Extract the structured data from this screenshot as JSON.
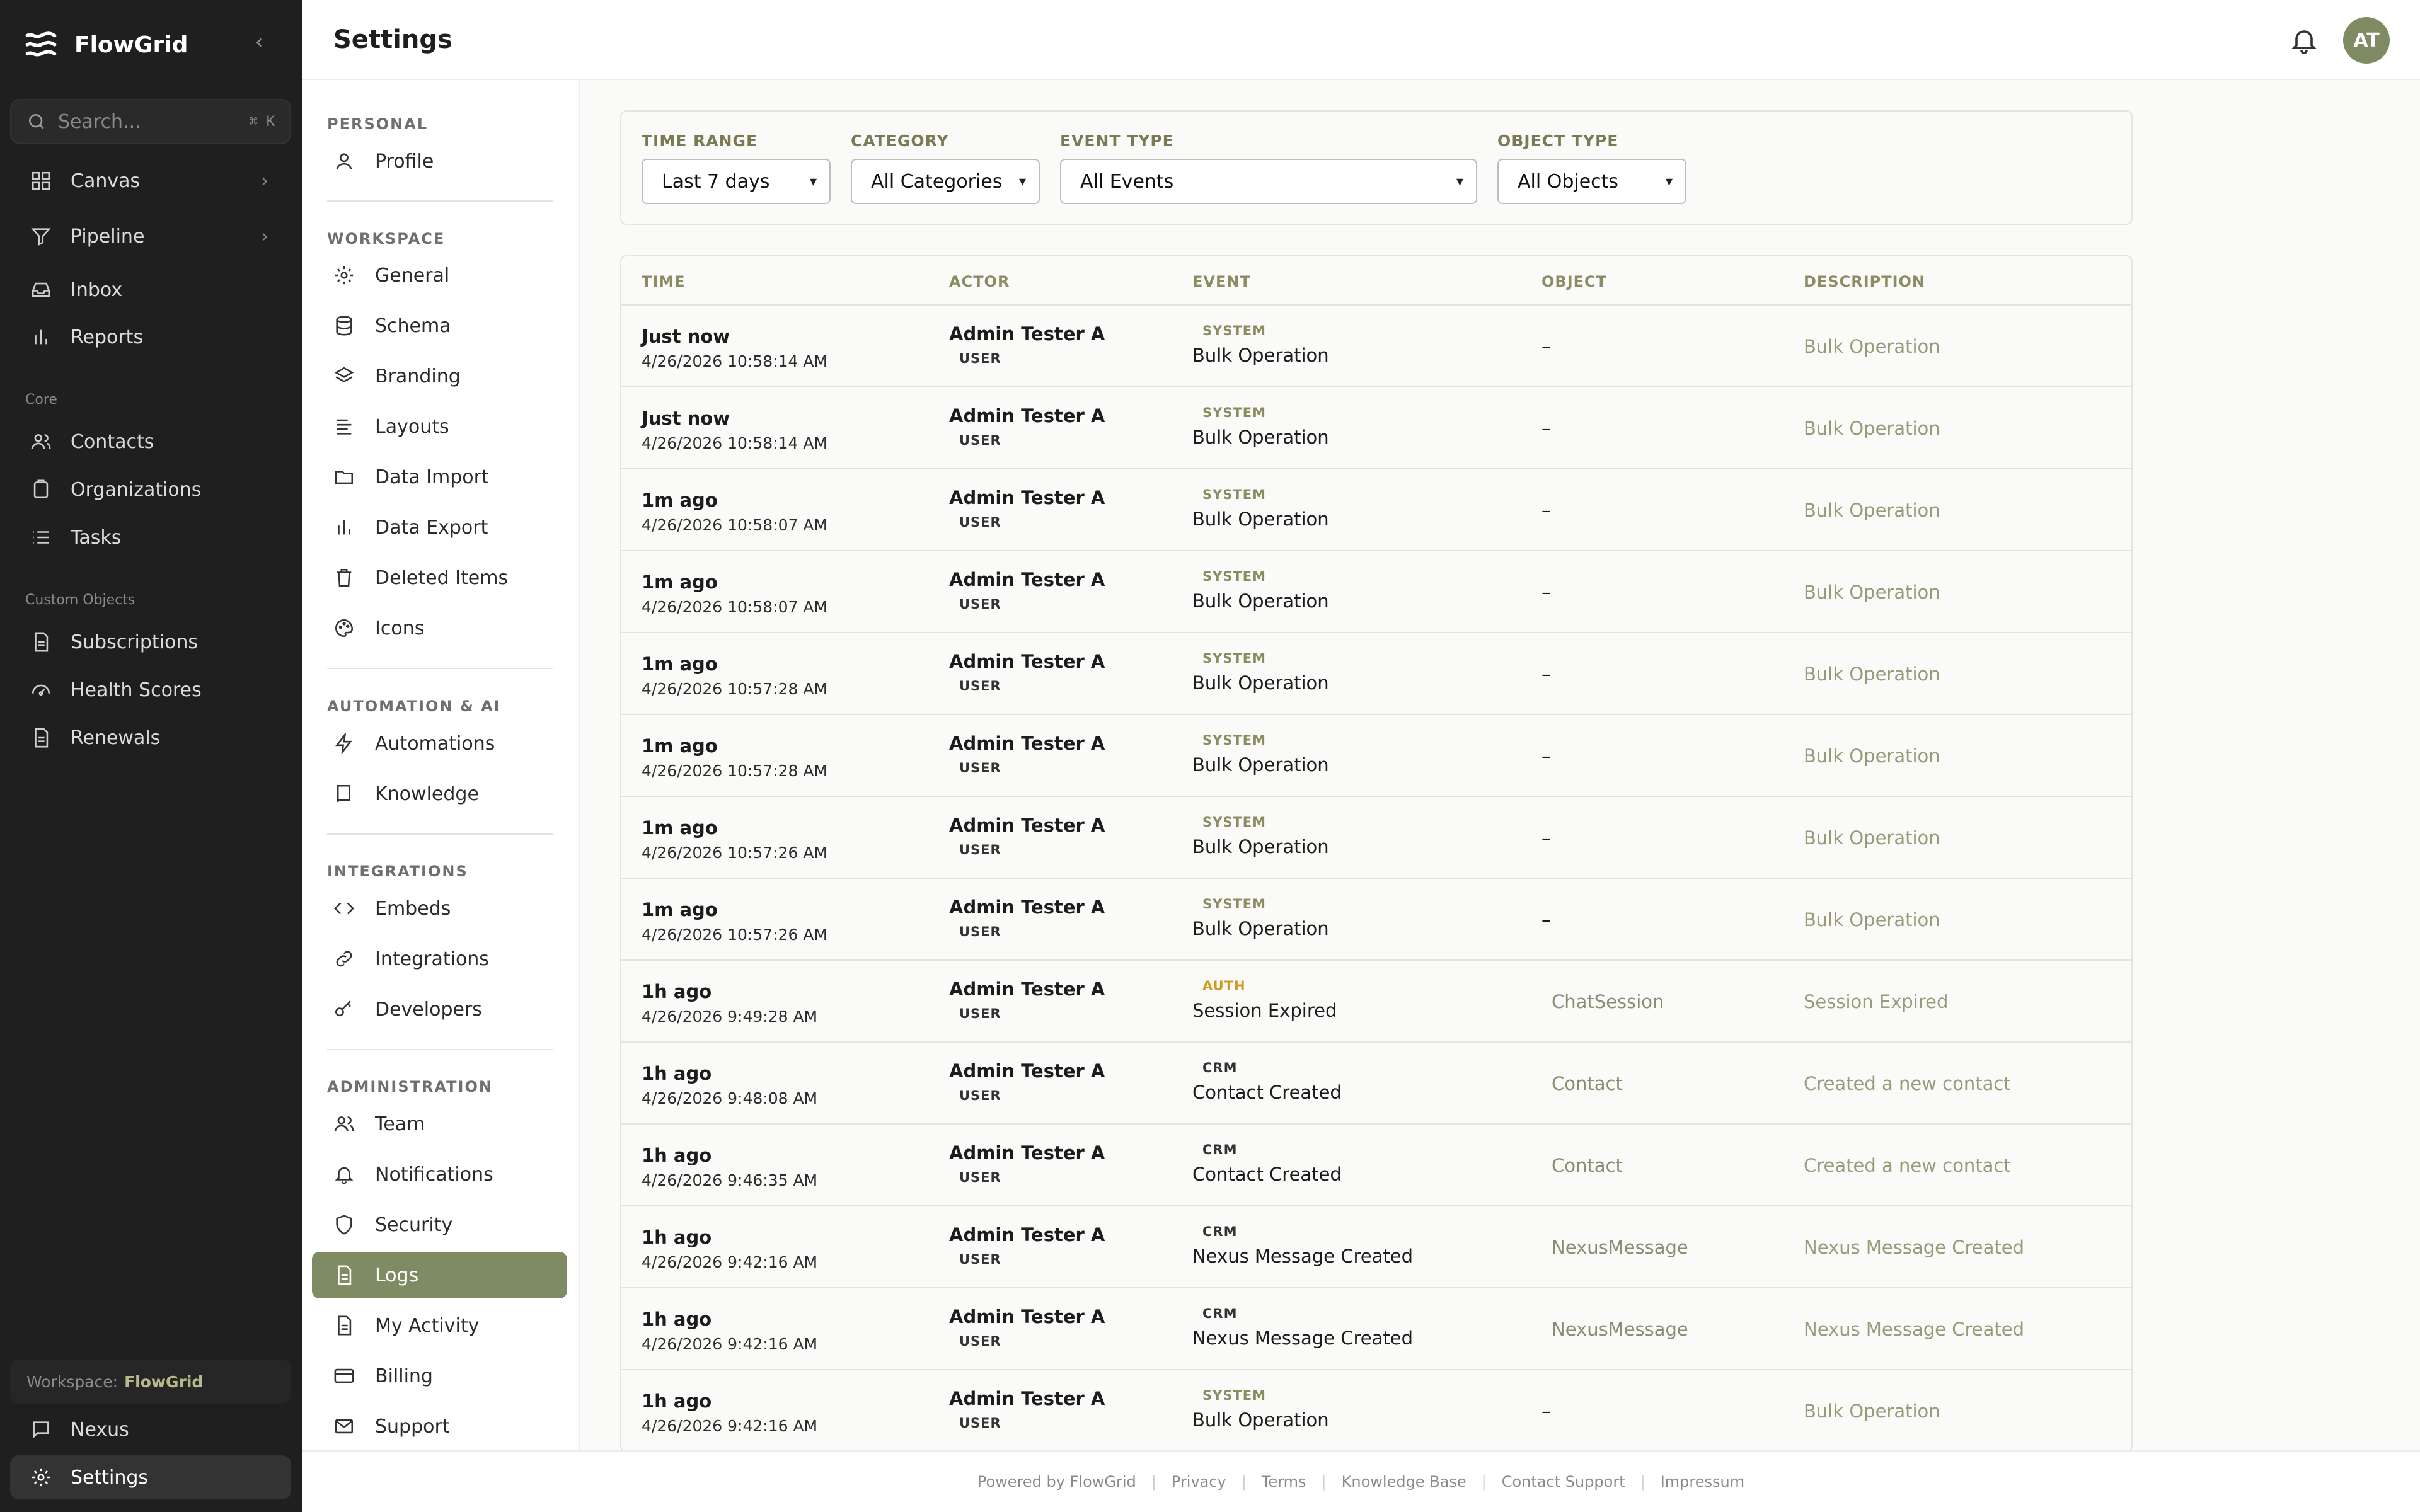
{
  "app": {
    "name": "FlowGrid"
  },
  "search": {
    "placeholder": "Search...",
    "shortcut_cmd": "⌘",
    "shortcut_key": "K"
  },
  "nav": {
    "primary": [
      {
        "label": "Canvas",
        "icon": "grid-icon"
      },
      {
        "label": "Pipeline",
        "icon": "filter-icon"
      },
      {
        "label": "Inbox",
        "icon": "inbox-icon"
      },
      {
        "label": "Reports",
        "icon": "bar-chart-icon"
      }
    ],
    "core_title": "Core",
    "core": [
      {
        "label": "Contacts",
        "icon": "users-icon"
      },
      {
        "label": "Organizations",
        "icon": "clipboard-icon"
      },
      {
        "label": "Tasks",
        "icon": "list-icon"
      }
    ],
    "custom_title": "Custom Objects",
    "custom": [
      {
        "label": "Subscriptions",
        "icon": "document-icon"
      },
      {
        "label": "Health Scores",
        "icon": "gauge-icon"
      },
      {
        "label": "Renewals",
        "icon": "document-icon"
      }
    ],
    "workspace_label": "Workspace:",
    "workspace_name": "FlowGrid",
    "nexus": "Nexus",
    "settings": "Settings"
  },
  "header": {
    "title": "Settings",
    "avatar_initials": "AT"
  },
  "settings_nav": {
    "personal_title": "PERSONAL",
    "personal": [
      "Profile"
    ],
    "workspace_title": "WORKSPACE",
    "workspace": [
      "General",
      "Schema",
      "Branding",
      "Layouts",
      "Data Import",
      "Data Export",
      "Deleted Items",
      "Icons"
    ],
    "automation_title": "AUTOMATION & AI",
    "automation": [
      "Automations",
      "Knowledge"
    ],
    "integrations_title": "INTEGRATIONS",
    "integrations": [
      "Embeds",
      "Integrations",
      "Developers"
    ],
    "admin_title": "ADMINISTRATION",
    "admin": [
      "Team",
      "Notifications",
      "Security",
      "Logs",
      "My Activity",
      "Billing",
      "Support"
    ],
    "active": "Logs"
  },
  "filters": {
    "time_range": {
      "label": "TIME RANGE",
      "value": "Last 7 days"
    },
    "category": {
      "label": "CATEGORY",
      "value": "All Categories"
    },
    "event_type": {
      "label": "EVENT TYPE",
      "value": "All Events"
    },
    "object_type": {
      "label": "OBJECT TYPE",
      "value": "All Objects"
    }
  },
  "table": {
    "columns": [
      "TIME",
      "ACTOR",
      "EVENT",
      "OBJECT",
      "DESCRIPTION"
    ],
    "rows": [
      {
        "rel": "Just now",
        "abs": "4/26/2026 10:58:14 AM",
        "actor": "Admin Tester A",
        "role": "USER",
        "cat": "SYSTEM",
        "event": "Bulk Operation",
        "object": "–",
        "desc": "Bulk Operation"
      },
      {
        "rel": "Just now",
        "abs": "4/26/2026 10:58:14 AM",
        "actor": "Admin Tester A",
        "role": "USER",
        "cat": "SYSTEM",
        "event": "Bulk Operation",
        "object": "–",
        "desc": "Bulk Operation"
      },
      {
        "rel": "1m ago",
        "abs": "4/26/2026 10:58:07 AM",
        "actor": "Admin Tester A",
        "role": "USER",
        "cat": "SYSTEM",
        "event": "Bulk Operation",
        "object": "–",
        "desc": "Bulk Operation"
      },
      {
        "rel": "1m ago",
        "abs": "4/26/2026 10:58:07 AM",
        "actor": "Admin Tester A",
        "role": "USER",
        "cat": "SYSTEM",
        "event": "Bulk Operation",
        "object": "–",
        "desc": "Bulk Operation"
      },
      {
        "rel": "1m ago",
        "abs": "4/26/2026 10:57:28 AM",
        "actor": "Admin Tester A",
        "role": "USER",
        "cat": "SYSTEM",
        "event": "Bulk Operation",
        "object": "–",
        "desc": "Bulk Operation"
      },
      {
        "rel": "1m ago",
        "abs": "4/26/2026 10:57:28 AM",
        "actor": "Admin Tester A",
        "role": "USER",
        "cat": "SYSTEM",
        "event": "Bulk Operation",
        "object": "–",
        "desc": "Bulk Operation"
      },
      {
        "rel": "1m ago",
        "abs": "4/26/2026 10:57:26 AM",
        "actor": "Admin Tester A",
        "role": "USER",
        "cat": "SYSTEM",
        "event": "Bulk Operation",
        "object": "–",
        "desc": "Bulk Operation"
      },
      {
        "rel": "1m ago",
        "abs": "4/26/2026 10:57:26 AM",
        "actor": "Admin Tester A",
        "role": "USER",
        "cat": "SYSTEM",
        "event": "Bulk Operation",
        "object": "–",
        "desc": "Bulk Operation"
      },
      {
        "rel": "1h ago",
        "abs": "4/26/2026 9:49:28 AM",
        "actor": "Admin Tester A",
        "role": "USER",
        "cat": "AUTH",
        "event": "Session Expired",
        "object": "ChatSession",
        "desc": "Session Expired"
      },
      {
        "rel": "1h ago",
        "abs": "4/26/2026 9:48:08 AM",
        "actor": "Admin Tester A",
        "role": "USER",
        "cat": "CRM",
        "event": "Contact Created",
        "object": "Contact",
        "desc": "Created a new contact"
      },
      {
        "rel": "1h ago",
        "abs": "4/26/2026 9:46:35 AM",
        "actor": "Admin Tester A",
        "role": "USER",
        "cat": "CRM",
        "event": "Contact Created",
        "object": "Contact",
        "desc": "Created a new contact"
      },
      {
        "rel": "1h ago",
        "abs": "4/26/2026 9:42:16 AM",
        "actor": "Admin Tester A",
        "role": "USER",
        "cat": "CRM",
        "event": "Nexus Message Created",
        "object": "NexusMessage",
        "desc": "Nexus Message Created"
      },
      {
        "rel": "1h ago",
        "abs": "4/26/2026 9:42:16 AM",
        "actor": "Admin Tester A",
        "role": "USER",
        "cat": "CRM",
        "event": "Nexus Message Created",
        "object": "NexusMessage",
        "desc": "Nexus Message Created"
      },
      {
        "rel": "1h ago",
        "abs": "4/26/2026 9:42:16 AM",
        "actor": "Admin Tester A",
        "role": "USER",
        "cat": "SYSTEM",
        "event": "Bulk Operation",
        "object": "–",
        "desc": "Bulk Operation"
      }
    ]
  },
  "footer": [
    "Powered by FlowGrid",
    "Privacy",
    "Terms",
    "Knowledge Base",
    "Contact Support",
    "Impressum"
  ],
  "colors": {
    "accent": "#7f8b62",
    "sidebar_bg": "#1f1f1f",
    "auth": "#d19a20"
  }
}
